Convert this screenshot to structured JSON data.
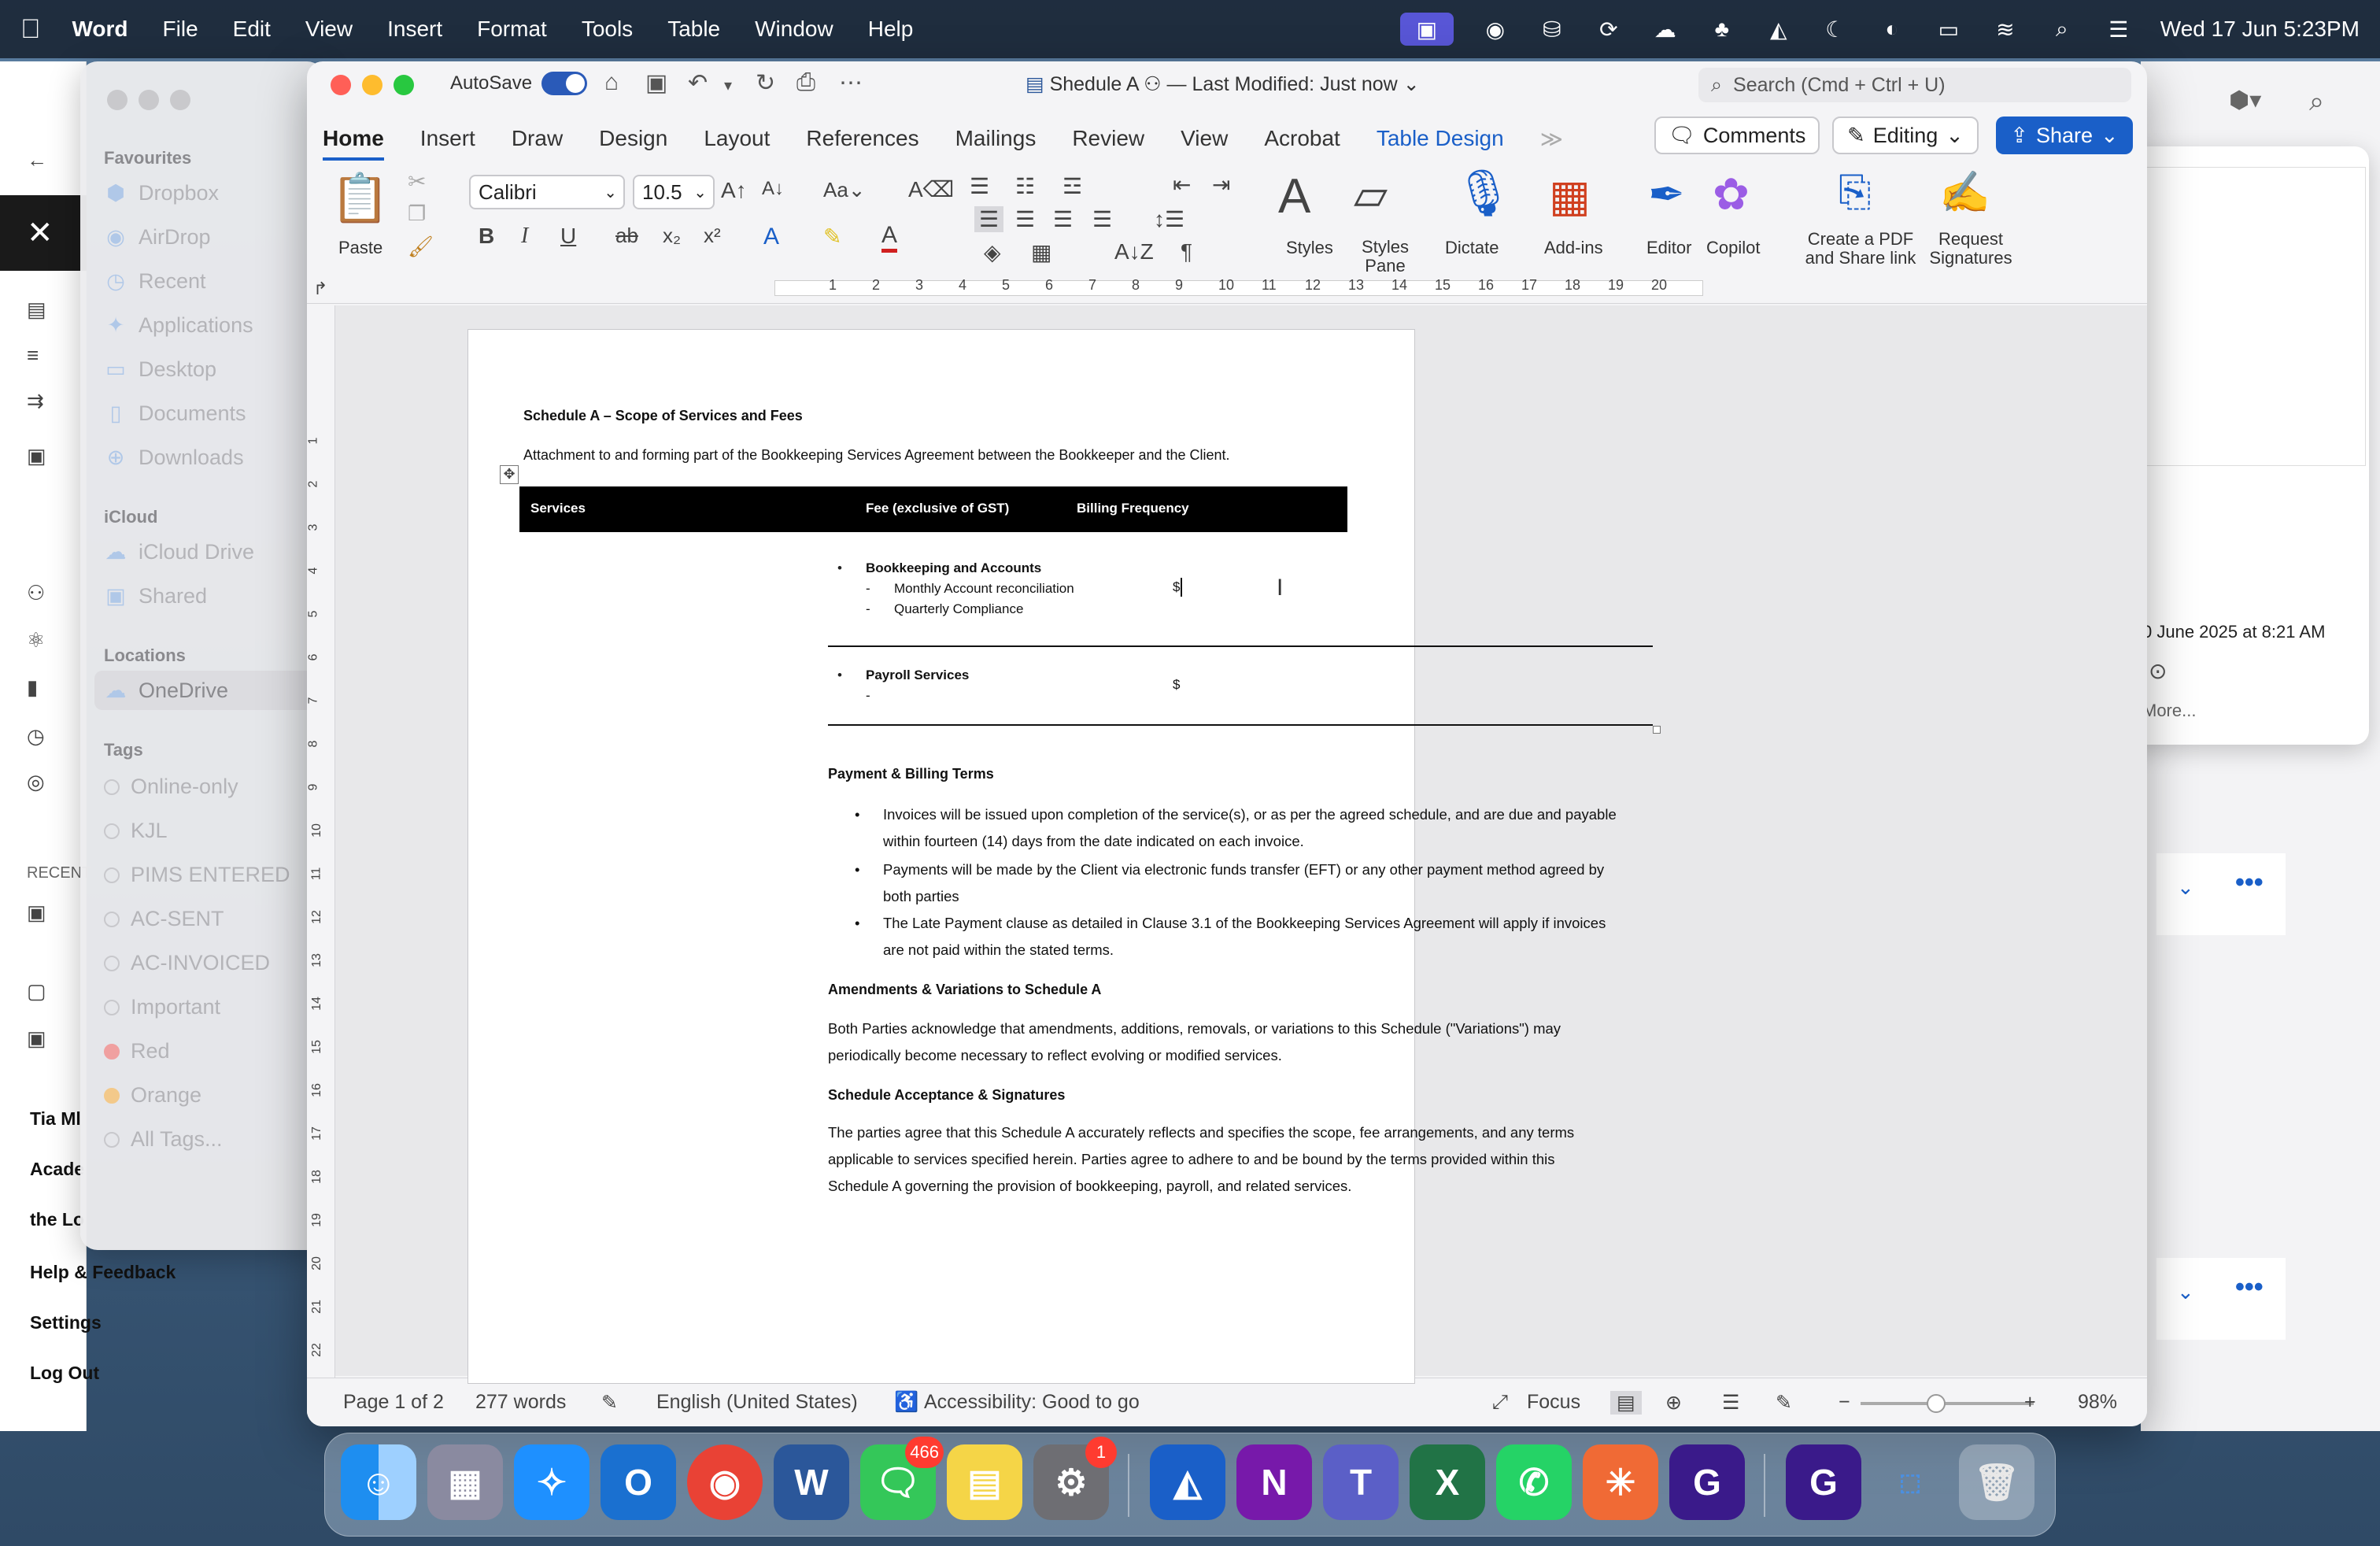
{
  "menubar": {
    "app": "Word",
    "items": [
      "File",
      "Edit",
      "View",
      "Insert",
      "Format",
      "Tools",
      "Table",
      "Window",
      "Help"
    ],
    "clock": "Wed 17 Jun  5:23PM"
  },
  "bgapp": {
    "recent_label": "RECENT",
    "items": [
      "Tia Ml",
      "Acade",
      "the Lo",
      "Help & Feedback",
      "Settings",
      "Log Out"
    ]
  },
  "finder": {
    "favourites_label": "Favourites",
    "favourites": [
      "Dropbox",
      "AirDrop",
      "Recent",
      "Applications",
      "Desktop",
      "Documents",
      "Downloads"
    ],
    "icloud_label": "iCloud",
    "icloud": [
      "iCloud Drive",
      "Shared"
    ],
    "locations_label": "Locations",
    "locations": [
      "OneDrive"
    ],
    "tags_label": "Tags",
    "tags": [
      "Online-only",
      "KJL",
      "PIMS ENTERED",
      "AC-SENT",
      "AC-INVOICED",
      "Important",
      "Red",
      "Orange",
      "All Tags..."
    ]
  },
  "rpanel": {
    "date": "0 June 2025 at 8:21 AM",
    "more": "More..."
  },
  "word": {
    "autosave": "AutoSave",
    "title": "Shedule A",
    "modified": "— Last Modified: Just now",
    "search_placeholder": "Search (Cmd + Ctrl + U)",
    "tabs": [
      "Home",
      "Insert",
      "Draw",
      "Design",
      "Layout",
      "References",
      "Mailings",
      "Review",
      "View",
      "Acrobat",
      "Table Design"
    ],
    "comments": "Comments",
    "editing": "Editing",
    "share": "Share",
    "ribbon": {
      "paste": "Paste",
      "font": "Calibri",
      "size": "10.5",
      "styles": "Styles",
      "styles_pane": "Styles Pane",
      "dictate": "Dictate",
      "addins": "Add-ins",
      "editor": "Editor",
      "copilot": "Copilot",
      "create_pdf": "Create a PDF and Share link",
      "request_sig": "Request Signatures"
    },
    "status": {
      "page": "Page 1 of 2",
      "words": "277 words",
      "language": "English (United States)",
      "accessibility": "Accessibility: Good to go",
      "focus": "Focus",
      "zoom": "98%"
    }
  },
  "document": {
    "heading": "Schedule A – Scope of Services and Fees",
    "intro": "Attachment to and forming part of the Bookkeeping Services Agreement between the Bookkeeper and the Client.",
    "table_headers": [
      "Services",
      "Fee (exclusive of GST)",
      "Billing Frequency"
    ],
    "rows": [
      {
        "service": "Bookkeeping and Accounts",
        "subs": [
          "Monthly Account reconciliation",
          "Quarterly Compliance"
        ],
        "fee": "$"
      },
      {
        "service": "Payroll Services",
        "subs": [
          ""
        ],
        "fee": "$"
      }
    ],
    "payment_heading": "Payment & Billing Terms",
    "payment_bullets": [
      [
        "Invoices will be issued upon completion of the service(s), or as per the agreed schedule, and are due and payable",
        "within fourteen (14) days from the date indicated on each invoice."
      ],
      [
        "Payments will be made by the Client via electronic funds transfer (EFT) or any other payment method agreed by",
        "both parties"
      ],
      [
        "The Late Payment clause as detailed in Clause 3.1 of the Bookkeeping Services Agreement will apply if invoices",
        "are not paid within the stated terms."
      ]
    ],
    "amend_heading": "Amendments & Variations to Schedule A",
    "amend_text": [
      "Both Parties acknowledge that amendments, additions, removals, or variations to this Schedule (\"Variations\") may",
      "periodically become necessary to reflect evolving or modified services."
    ],
    "accept_heading": "Schedule Acceptance & Signatures",
    "accept_text": [
      "The parties agree that this Schedule A accurately reflects and specifies the scope, fee arrangements, and any terms",
      "applicable to services specified herein. Parties agree to adhere to and be bound by the terms provided within this",
      "Schedule A governing the provision of bookkeeping, payroll, and related services."
    ]
  },
  "dock": {
    "messages_badge": "466",
    "settings_badge": "1"
  }
}
